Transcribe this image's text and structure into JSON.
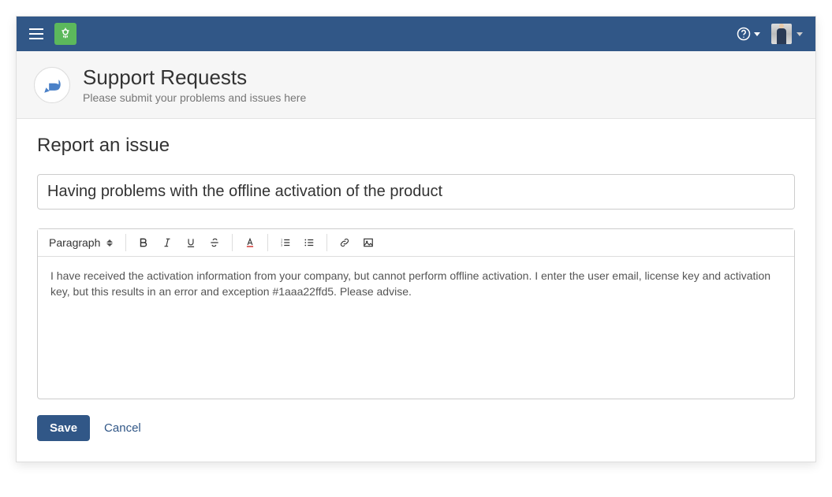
{
  "header": {
    "title": "Support Requests",
    "subtitle": "Please submit your problems and issues here"
  },
  "form": {
    "heading": "Report an issue",
    "title_value": "Having problems with the offline activation of the product",
    "body_value": "I have received the activation information from your company, but cannot perform offline activation. I enter the user email, license key and activation key, but this results in an error and exception #1aaa22ffd5. Please advise."
  },
  "toolbar": {
    "format_label": "Paragraph"
  },
  "actions": {
    "save": "Save",
    "cancel": "Cancel"
  }
}
